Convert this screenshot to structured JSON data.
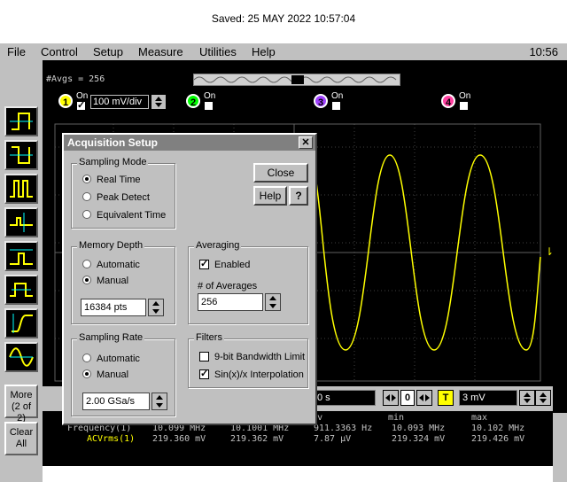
{
  "saved_text": "Saved:  25 MAY 2022  10:57:04",
  "menu": {
    "file": "File",
    "control": "Control",
    "setup": "Setup",
    "measure": "Measure",
    "utilities": "Utilities",
    "help": "Help",
    "clock": "10:56"
  },
  "scope": {
    "avgs_label": "#Avgs = 256",
    "channels": [
      {
        "num": "1",
        "on_label": "On",
        "checked": true,
        "color": "#ffff00"
      },
      {
        "num": "2",
        "on_label": "On",
        "checked": false,
        "color": "#00ff00"
      },
      {
        "num": "3",
        "on_label": "On",
        "checked": false,
        "color": "#a040ff"
      },
      {
        "num": "4",
        "on_label": "On",
        "checked": false,
        "color": "#ff40a0"
      }
    ],
    "volt_div": "100 mV/div",
    "time_field": "0 s",
    "trigger_level": "3 mV",
    "trigger_label": "T",
    "delay_value": "0",
    "trace_color": "#ffff00"
  },
  "side": {
    "more_label": "More\n(2 of 2)",
    "more_line1": "More",
    "more_line2": "(2 of 2)",
    "clear_line1": "Clear",
    "clear_line2": "All"
  },
  "measurements": {
    "headers": [
      "td dev",
      "min",
      "max"
    ],
    "rows": [
      {
        "name": "Frequency(1)",
        "cur": "10.099 MHz",
        "mean": "10.1001 MHz",
        "std": "911.3363  Hz",
        "min": "10.093 MHz",
        "max": "10.102 MHz"
      },
      {
        "name": "ACVrms(1)",
        "cur": "219.360 mV",
        "mean": "219.362 mV",
        "std": "7.87 µV",
        "min": "219.324 mV",
        "max": "219.426 mV"
      }
    ]
  },
  "dialog": {
    "title": "Acquisition Setup",
    "close_glyph": "✕",
    "close_button": "Close",
    "help_button": "Help",
    "help_icon": "?",
    "sampling_mode": {
      "label": "Sampling Mode",
      "options": [
        "Real Time",
        "Peak Detect",
        "Equivalent Time"
      ],
      "selected": 0
    },
    "memory_depth": {
      "label": "Memory Depth",
      "options": [
        "Automatic",
        "Manual"
      ],
      "selected": 1,
      "value": "16384 pts"
    },
    "averaging": {
      "label": "Averaging",
      "enabled_label": "Enabled",
      "enabled": true,
      "count_label": "# of Averages",
      "count_value": "256"
    },
    "sampling_rate": {
      "label": "Sampling Rate",
      "options": [
        "Automatic",
        "Manual"
      ],
      "selected": 1,
      "value": "2.00 GSa/s"
    },
    "filters": {
      "label": "Filters",
      "options": [
        {
          "label": "9-bit Bandwidth Limit",
          "checked": false
        },
        {
          "label": "Sin(x)/x Interpolation",
          "checked": true
        }
      ]
    }
  }
}
